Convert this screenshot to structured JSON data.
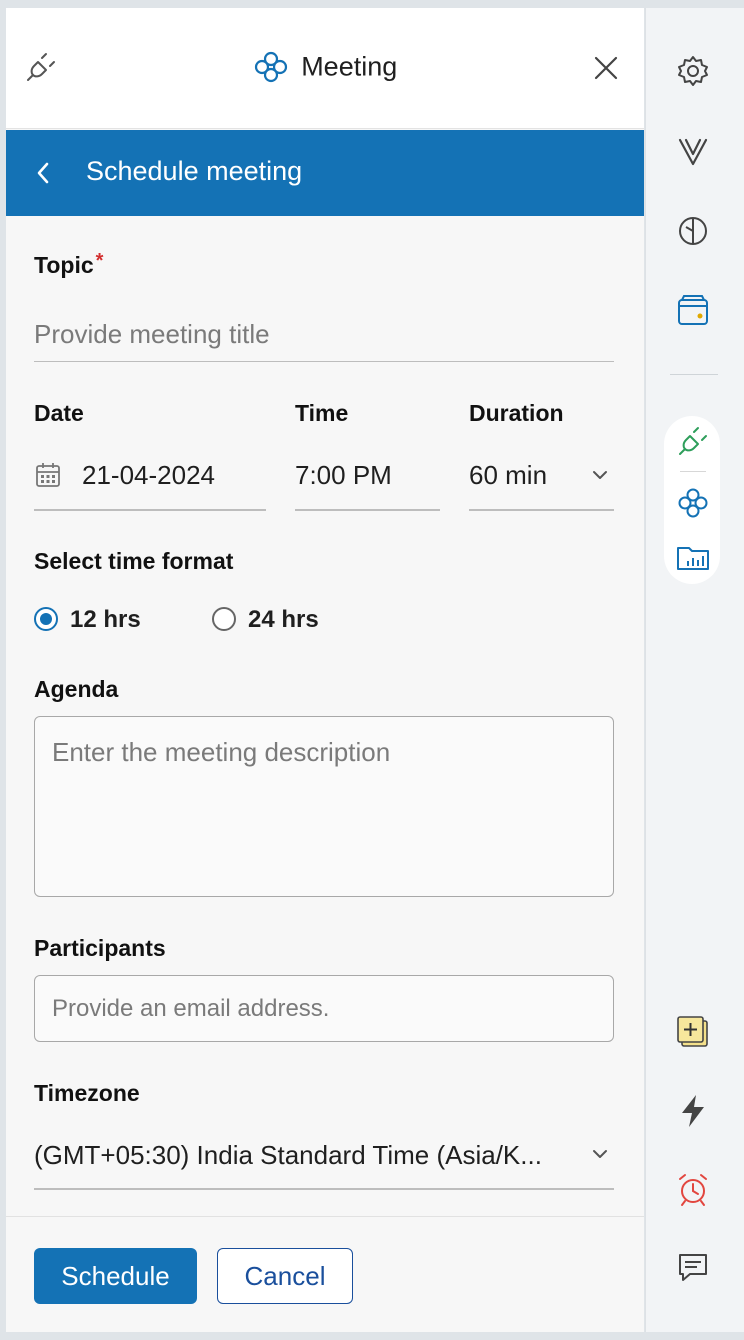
{
  "header": {
    "title": "Meeting"
  },
  "subheader": {
    "title": "Schedule meeting"
  },
  "form": {
    "topic": {
      "label": "Topic",
      "required_mark": "*",
      "placeholder": "Provide meeting title",
      "value": ""
    },
    "date": {
      "label": "Date",
      "value": "21-04-2024"
    },
    "time": {
      "label": "Time",
      "value": "7:00 PM"
    },
    "duration": {
      "label": "Duration",
      "value": "60 min"
    },
    "time_format": {
      "label": "Select time format",
      "options": [
        {
          "label": "12 hrs",
          "selected": true
        },
        {
          "label": "24 hrs",
          "selected": false
        }
      ]
    },
    "agenda": {
      "label": "Agenda",
      "placeholder": "Enter the meeting description"
    },
    "participants": {
      "label": "Participants",
      "placeholder": "Provide an email address."
    },
    "timezone": {
      "label": "Timezone",
      "value": "(GMT+05:30) India Standard Time (Asia/K..."
    }
  },
  "actions": {
    "schedule": "Schedule",
    "cancel": "Cancel"
  },
  "rail_icons": [
    "gear-icon",
    "vault-icon",
    "clock-split-icon",
    "wallet-icon",
    "plug-icon",
    "meeting-logo-icon",
    "folder-chart-icon",
    "sticky-note-add-icon",
    "bolt-icon",
    "alarm-clock-icon",
    "chat-icon"
  ],
  "colors": {
    "accent": "#1472b5",
    "required": "#d32f2f"
  }
}
